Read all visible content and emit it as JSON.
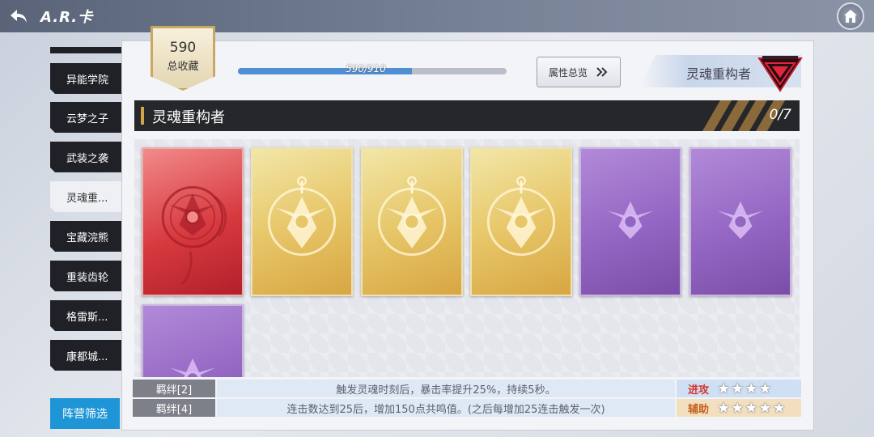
{
  "header": {
    "title": "A.R.卡"
  },
  "sidebar": {
    "items": [
      {
        "label": "异能学院"
      },
      {
        "label": "云梦之子"
      },
      {
        "label": "武装之袭"
      },
      {
        "label": "灵魂重..."
      },
      {
        "label": "宝藏浣熊"
      },
      {
        "label": "重装齿轮"
      },
      {
        "label": "格雷斯..."
      },
      {
        "label": "康都城..."
      }
    ],
    "active_index": 3,
    "faction_filter_label": "阵营筛选"
  },
  "collection": {
    "count": "590",
    "count_label": "总收藏",
    "progress_text": "590/910",
    "progress_fraction": 0.648
  },
  "overview_button": {
    "label": "属性总览"
  },
  "faction": {
    "name": "灵魂重构者"
  },
  "section": {
    "title": "灵魂重构者",
    "count": "0/7"
  },
  "cards": [
    {
      "rarity": "red"
    },
    {
      "rarity": "gold"
    },
    {
      "rarity": "gold"
    },
    {
      "rarity": "gold"
    },
    {
      "rarity": "purple"
    },
    {
      "rarity": "purple"
    },
    {
      "rarity": "purple"
    }
  ],
  "bonds": [
    {
      "label": "羁绊[2]",
      "description": "触发灵魂时刻后，暴击率提升25%，持续5秒。"
    },
    {
      "label": "羁绊[4]",
      "description": "连击数达到25后，增加150点共鸣值。(之后每增加25连击触发一次)"
    }
  ],
  "ratings": {
    "attack": {
      "label": "进攻",
      "stars": 4,
      "stars_text": "★★★★"
    },
    "support": {
      "label": "辅助",
      "stars": 5,
      "stars_text": "★★★★★"
    }
  },
  "colors": {
    "accent_blue": "#1d95d6",
    "red_card": "#d73a3f",
    "gold_card": "#e7c76a",
    "purple_card": "#9466c3"
  }
}
